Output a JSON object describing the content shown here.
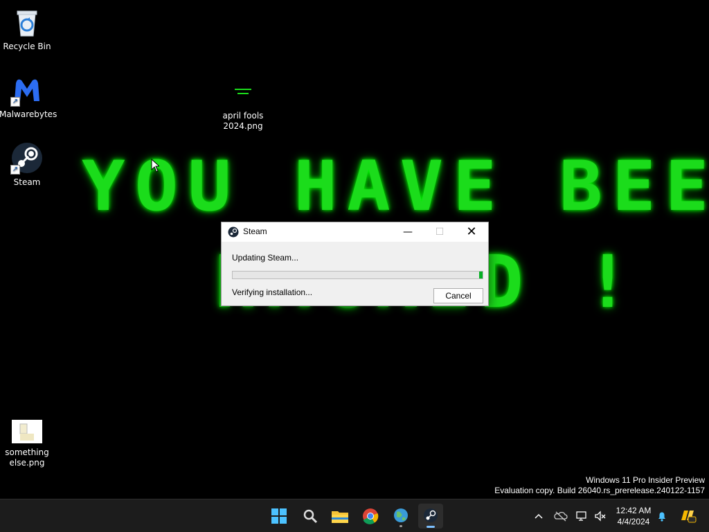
{
  "desktop": {
    "wallpaper_text": {
      "line1": "YOU HAVE BEEN",
      "line2": "HACKED !"
    },
    "icons": [
      {
        "label": "Recycle Bin",
        "icon": "recycle-bin-icon"
      },
      {
        "label": "Malwarebytes",
        "icon": "malwarebytes-icon"
      },
      {
        "label": "Steam",
        "icon": "steam-icon"
      },
      {
        "label": "april fools 2024.png",
        "icon": "image-file-icon"
      },
      {
        "label": "something else.png",
        "icon": "image-file-icon"
      }
    ]
  },
  "dialog": {
    "title": "Steam",
    "status": "Updating Steam...",
    "progress_fraction": 0.985,
    "substatus": "Verifying installation...",
    "cancel_label": "Cancel",
    "minimize_glyph": "—",
    "maximize_glyph": "☐",
    "close_glyph": "✕"
  },
  "watermark": {
    "line1": "Windows 11 Pro Insider Preview",
    "line2": "Evaluation copy. Build 26040.rs_prerelease.240122-1157"
  },
  "taskbar": {
    "apps": [
      "start-icon",
      "search-icon",
      "file-explorer-icon",
      "chrome-icon",
      "globe-app-icon",
      "steam-icon"
    ],
    "tray": [
      "chevron-up-icon",
      "onedrive-icon",
      "network-icon",
      "volume-icon",
      "notification-bell-icon",
      "copilot-icon"
    ],
    "clock": {
      "time": "12:42 AM",
      "date": "4/4/2024"
    },
    "colors": {
      "accent": "#7cc0ff",
      "progress": "#06b025",
      "wallpaper_text": "#1bdc1b"
    }
  }
}
